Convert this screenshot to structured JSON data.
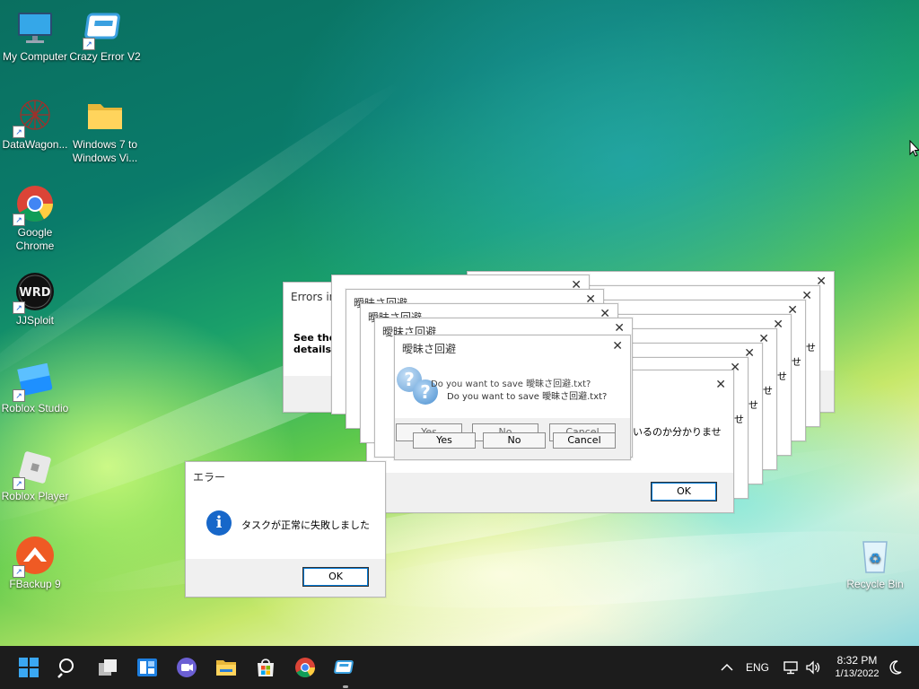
{
  "desktop": {
    "icons": [
      {
        "label": "My Computer",
        "icon": "monitor-icon"
      },
      {
        "label": "Crazy Error V2",
        "icon": "crazy-error-icon"
      },
      {
        "label": "DataWagon...",
        "icon": "datawagon-icon"
      },
      {
        "label": "Windows 7 to Windows Vi...",
        "icon": "folder-icon"
      },
      {
        "label": "Google Chrome",
        "icon": "chrome-icon"
      },
      {
        "label": "JJSploit",
        "icon": "jjsploit-icon"
      },
      {
        "label": "Roblox Studio",
        "icon": "roblox-studio-icon"
      },
      {
        "label": "Roblox Player",
        "icon": "roblox-player-icon"
      },
      {
        "label": "FBackup 9",
        "icon": "fbackup-icon"
      },
      {
        "label": "Recycle Bin",
        "icon": "recycle-bin-icon"
      }
    ],
    "jjsploit_glyph": "WRD"
  },
  "dialogs": {
    "errors_in": {
      "title": "Errors in",
      "body_line1": "See the",
      "body_line2": "details"
    },
    "jp_title": "曖昧さ回避",
    "save_question": "Do you want to save 曖昧さ回避.txt?",
    "yes_label": "Yes",
    "no_label": "No",
    "cancel_label": "Cancel",
    "ok_label": "OK",
    "back_message": "いるのか分かりませ",
    "back_fragment": "せ",
    "error_jp": {
      "title": "エラー",
      "message": "タスクが正常に失敗しました",
      "ok_label": "OK"
    }
  },
  "taskbar": {
    "language": "ENG",
    "time": "8:32 PM",
    "date": "1/13/2022"
  },
  "colors": {
    "taskbar_bg": "#1c1c1c",
    "accent": "#0078d4"
  }
}
